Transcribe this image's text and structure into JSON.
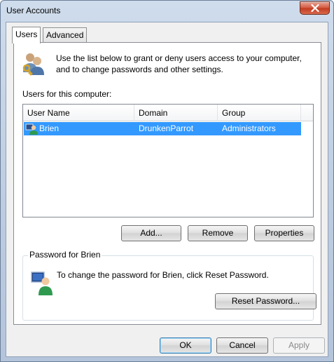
{
  "window": {
    "title": "User Accounts"
  },
  "tabs": [
    {
      "label": "Users",
      "active": true
    },
    {
      "label": "Advanced",
      "active": false
    }
  ],
  "intro": {
    "line1": "Use the list below to grant or deny users access to your computer,",
    "line2": "and to change passwords and other settings.",
    "icon": "users-keys-icon"
  },
  "users_list": {
    "label": "Users for this computer:",
    "columns": [
      "User Name",
      "Domain",
      "Group"
    ],
    "rows": [
      {
        "user_name": "Brien",
        "domain": "DrunkenParrot",
        "group": "Administrators",
        "selected": true
      }
    ]
  },
  "list_buttons": {
    "add": "Add...",
    "remove": "Remove",
    "properties": "Properties"
  },
  "password": {
    "group_title": "Password for Brien",
    "text": "To change the password for Brien, click Reset Password.",
    "reset_button": "Reset Password...",
    "icon": "user-computer-icon"
  },
  "dialog_buttons": {
    "ok": "OK",
    "cancel": "Cancel",
    "apply": "Apply"
  },
  "colors": {
    "selection": "#3399ff",
    "close_button": "#c8472b",
    "frame": "#bccbe0"
  }
}
